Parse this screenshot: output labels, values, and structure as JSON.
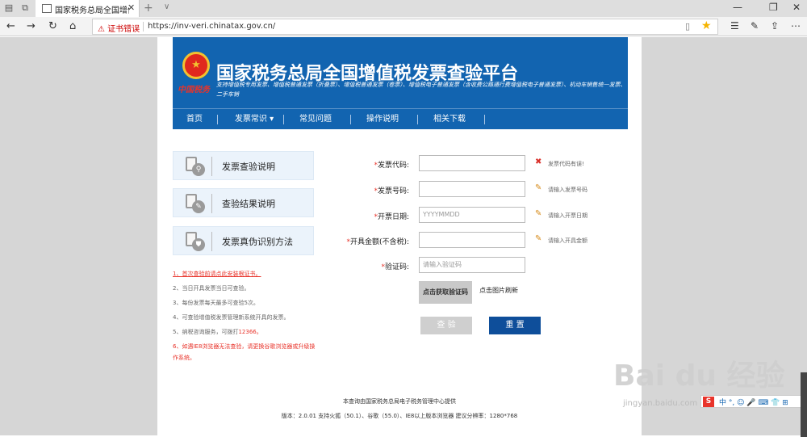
{
  "browser": {
    "tab_title": "国家税务总局全国增值税",
    "cert_warning": "证书错误",
    "url": "https://inv-veri.chinatax.gov.cn/"
  },
  "banner": {
    "slogan": "中国税务",
    "title": "国家税务总局全国增值税发票查验平台",
    "subtitle": "支持增值税专用发票、增值税普通发票（折叠票）、增值税普通发票（卷票）、增值税电子普通发票（含收费公路通行费增值税电子普通发票）、机动车销售统一发票、二手车销"
  },
  "nav": {
    "items": [
      {
        "label": "首页"
      },
      {
        "label": "发票常识"
      },
      {
        "label": "常见问题"
      },
      {
        "label": "操作说明"
      },
      {
        "label": "相关下载"
      }
    ]
  },
  "side": {
    "buttons": [
      {
        "label": "发票查验说明"
      },
      {
        "label": "查验结果说明"
      },
      {
        "label": "发票真伪识别方法"
      }
    ]
  },
  "notes": {
    "n1": "1、首次查验前请点此安装根证书。",
    "n2": "2、当日开具发票当日可查验。",
    "n3": "3、每份发票每天最多可查验5次。",
    "n4": "4、可查验增值税发票管理新系统开具的发票。",
    "n5a": "5、纳税咨询服务，可拨打",
    "n5b": "12366。",
    "n6a": "6、如遇IE8浏览器无法查验，请更换谷歌浏览器或升级操",
    "n6b": "作系统。"
  },
  "form": {
    "code": {
      "label": "发票代码:",
      "hint": "发票代码有误!"
    },
    "number": {
      "label": "发票号码:",
      "hint": "请输入发票号码"
    },
    "date": {
      "label": "开票日期:",
      "placeholder": "YYYYMMDD",
      "hint": "请输入开票日期"
    },
    "amount": {
      "label": "开具金额(不含税):",
      "hint": "请输入开具金额"
    },
    "verify_code": {
      "label": "验证码:",
      "placeholder": "请输入验证码"
    },
    "captcha": "点击获取验证码",
    "refresh": "点击图片刷新",
    "verify_btn": "查 验",
    "reset_btn": "重 置"
  },
  "footer": {
    "line1": "本查询由国家税务总局电子税务管理中心提供",
    "line2": "版本：2.0.01    支持火狐（50.1）、谷歌（55.0）、IE8以上版本浏览器    建议分辨率：1280*768"
  },
  "watermark": {
    "text": "Bai du 经验",
    "sub": "jingyan.baidu.com"
  },
  "ime": {
    "logo": "S",
    "text": "中 °, ☺ 🎤 ⌨ 👕 ⊞"
  }
}
